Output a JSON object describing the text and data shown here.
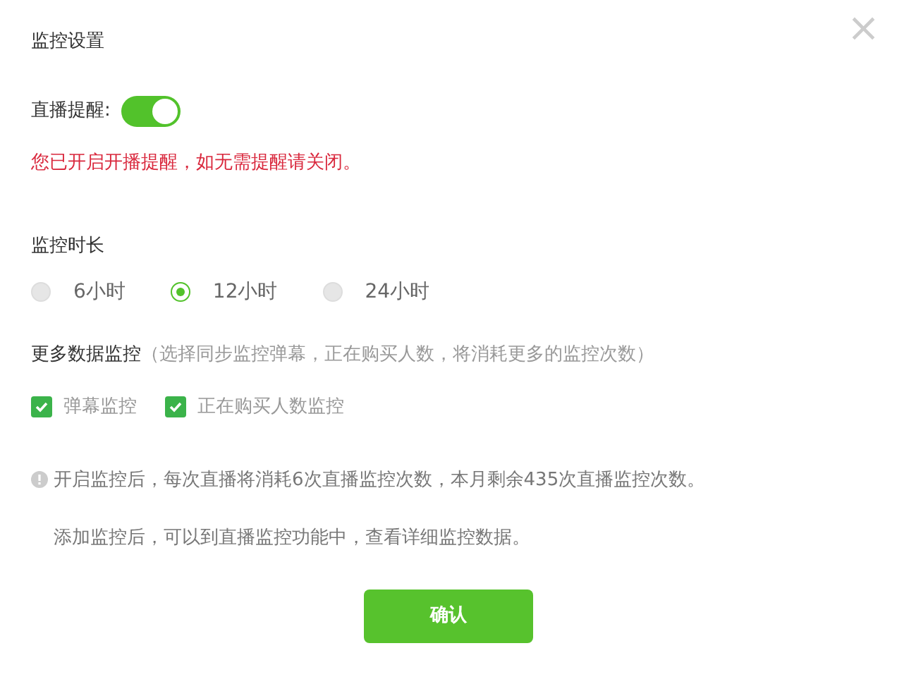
{
  "dialog": {
    "title": "监控设置",
    "close_icon": "×"
  },
  "live_reminder": {
    "label": "直播提醒:",
    "on": true,
    "notice": "您已开启开播提醒，如无需提醒请关闭。"
  },
  "duration": {
    "label": "监控时长",
    "options": [
      {
        "label": "6小时",
        "selected": false
      },
      {
        "label": "12小时",
        "selected": true
      },
      {
        "label": "24小时",
        "selected": false
      }
    ]
  },
  "more_data": {
    "label": "更多数据监控",
    "hint": "（选择同步监控弹幕，正在购买人数，将消耗更多的监控次数）",
    "options": [
      {
        "label": "弹幕监控",
        "checked": true
      },
      {
        "label": "正在购买人数监控",
        "checked": true
      }
    ]
  },
  "notes": [
    "开启监控后，每次直播将消耗6次直播监控次数，本月剩余435次直播监控次数。",
    "添加监控后，可以到直播监控功能中，查看详细监控数据。"
  ],
  "confirm_button": "确认"
}
